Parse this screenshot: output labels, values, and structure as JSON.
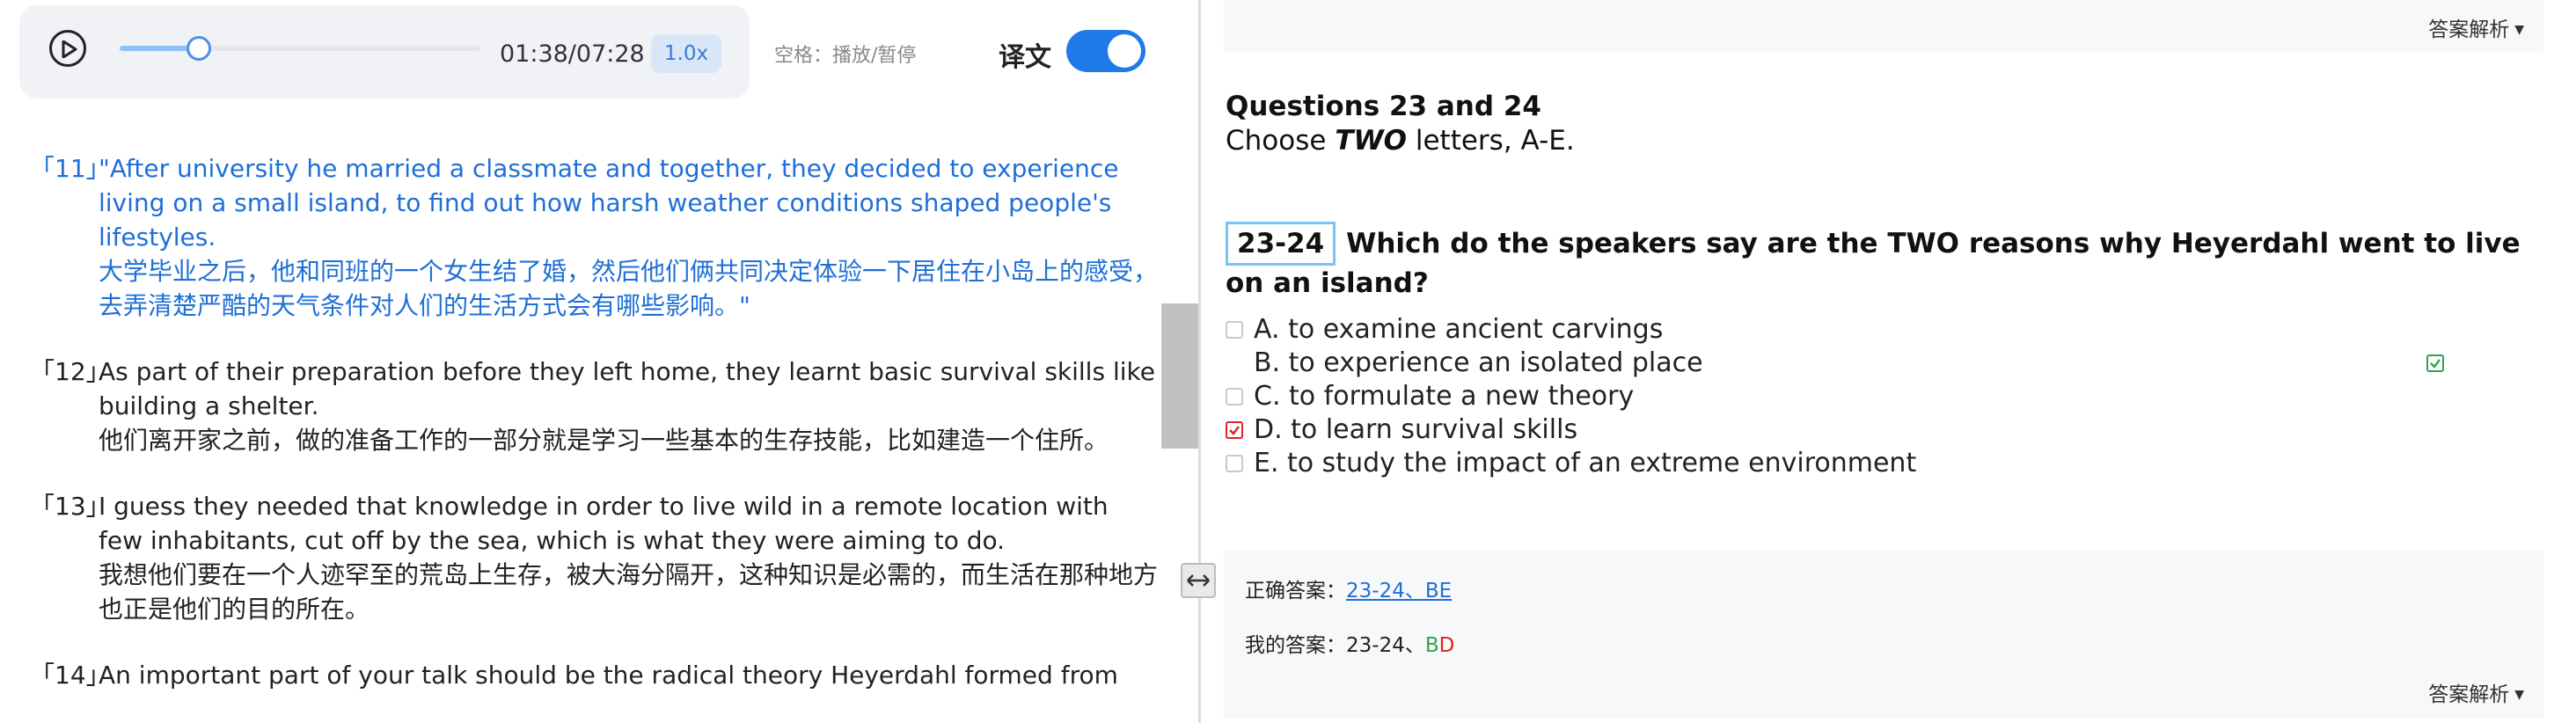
{
  "player": {
    "time": "01:38/07:28",
    "progress": 0.219,
    "speed": "1.0x",
    "hint": "空格：播放/暂停",
    "translation_label": "译文",
    "translation_on": true
  },
  "transcript": [
    {
      "num": "「11」",
      "active": true,
      "en": "\"After university he married a classmate and together, they decided to experience living on a small island, to find out how harsh weather conditions shaped people's lifestyles.",
      "zh": "大学毕业之后，他和同班的一个女生结了婚，然后他们俩共同决定体验一下居住在小岛上的感受，去弄清楚严酷的天气条件对人们的生活方式会有哪些影响。\""
    },
    {
      "num": "「12」",
      "active": false,
      "en": "As part of their preparation before they left home, they learnt basic survival skills like building a shelter.",
      "zh": "他们离开家之前，做的准备工作的一部分就是学习一些基本的生存技能，比如建造一个住所。"
    },
    {
      "num": "「13」",
      "active": false,
      "en": "I guess they needed that knowledge in order to live wild in a remote location with few inhabitants, cut off by the sea, which is what they were aiming to do.",
      "zh": "我想他们要在一个人迹罕至的荒岛上生存，被大海分隔开，这种知识是必需的，而生活在那种地方也正是他们的目的所在。"
    },
    {
      "num": "「14」",
      "active": false,
      "en": "An important part of your talk should be the radical theory Heyerdahl formed from",
      "zh": ""
    }
  ],
  "question": {
    "analysis_label": "答案解析",
    "heading": "Questions 23 and 24",
    "instruction_pre": "Choose ",
    "instruction_em": "TWO",
    "instruction_post": " letters, A-E.",
    "number": "23-24",
    "text": "Which do the speakers say are the TWO reasons why Heyerdahl went to live on an island?",
    "options": [
      {
        "label": "A. to examine ancient carvings",
        "state": "none"
      },
      {
        "label": "B. to experience an isolated place",
        "state": "correct"
      },
      {
        "label": "C. to formulate a new theory",
        "state": "none"
      },
      {
        "label": "D. to learn survival skills",
        "state": "wrong"
      },
      {
        "label": "E. to study the impact of an extreme environment",
        "state": "none"
      }
    ]
  },
  "answers": {
    "correct_label": "正确答案：",
    "correct_value": "23-24、BE",
    "mine_label": "我的答案：",
    "mine_prefix": "23-24、",
    "mine_ok": "B",
    "mine_bad": "D",
    "analysis_label": "答案解析"
  },
  "colors": {
    "accent": "#1f7ae8",
    "correct": "#2ea44f",
    "wrong": "#e02424"
  }
}
